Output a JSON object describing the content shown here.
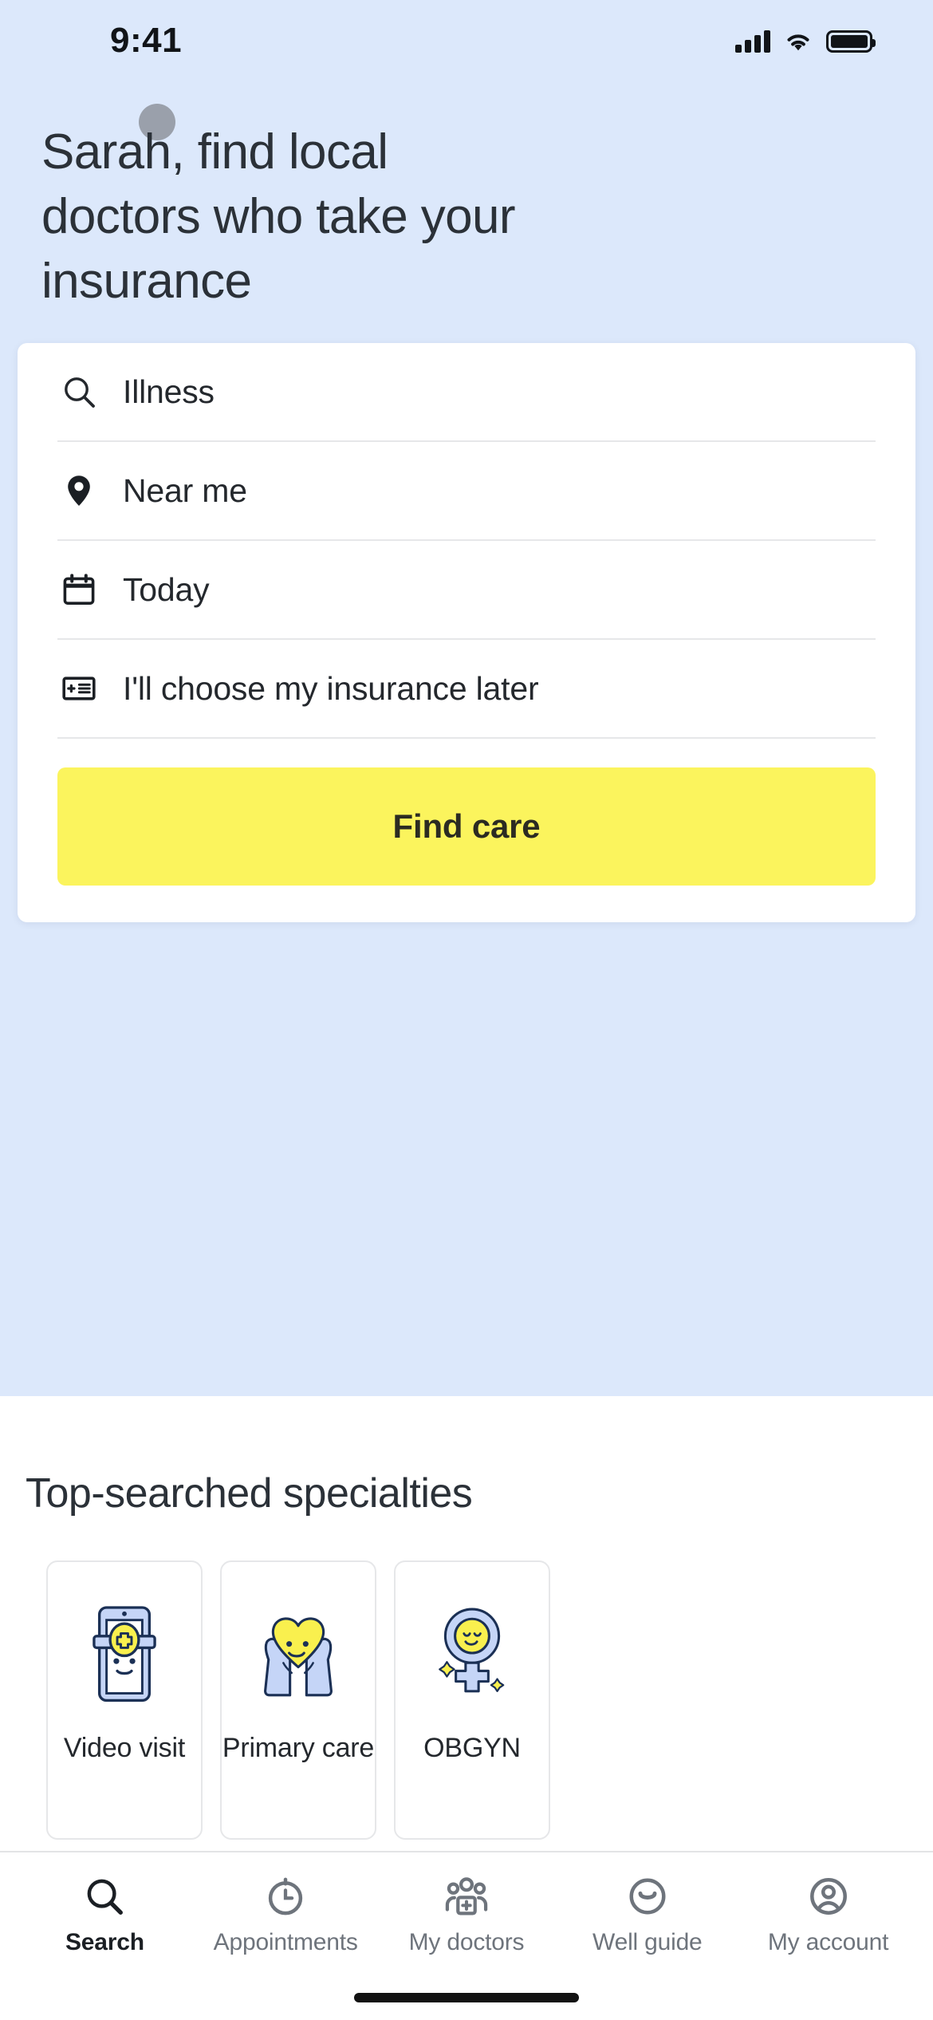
{
  "status_bar": {
    "time": "9:41",
    "cellular_icon": "cellular-signal-icon",
    "wifi_icon": "wifi-icon",
    "battery_icon": "battery-icon"
  },
  "hero": {
    "avatar_icon": "avatar-dot",
    "headline": "Sarah, find local doctors who take your insurance",
    "background_color": "#dce8fb"
  },
  "search_card": {
    "fields": [
      {
        "icon": "search-icon",
        "value": "Illness",
        "placeholder": "Illness"
      },
      {
        "icon": "location-pin-icon",
        "value": "Near me",
        "placeholder": "Near me"
      },
      {
        "icon": "calendar-icon",
        "value": "Today",
        "placeholder": "Today"
      },
      {
        "icon": "insurance-card-icon",
        "value": "I'll choose my insurance later",
        "placeholder": "Insurance"
      }
    ],
    "cta_label": "Find care",
    "cta_color": "#fbf45d"
  },
  "specialties": {
    "title": "Top-searched specialties",
    "cards": [
      {
        "label": "Video visit",
        "art": "tablet-doctor-illustration"
      },
      {
        "label": "Primary care",
        "art": "hands-heart-illustration"
      },
      {
        "label": "OBGYN",
        "art": "female-symbol-face-illustration"
      }
    ]
  },
  "tabbar": {
    "items": [
      {
        "label": "Search",
        "icon": "search-icon",
        "active": true
      },
      {
        "label": "Appointments",
        "icon": "clock-icon",
        "active": false
      },
      {
        "label": "My doctors",
        "icon": "group-plus-icon",
        "active": false
      },
      {
        "label": "Well guide",
        "icon": "smile-icon",
        "active": false
      },
      {
        "label": "My account",
        "icon": "account-icon",
        "active": false
      }
    ]
  },
  "colors": {
    "hero_blue": "#dce8fb",
    "accent_yellow": "#fbf45d",
    "illustration_blue": "#c5d5f7",
    "illustration_outline": "#1b3055",
    "text_dark": "#2b3138",
    "text_muted": "#6e747c"
  }
}
